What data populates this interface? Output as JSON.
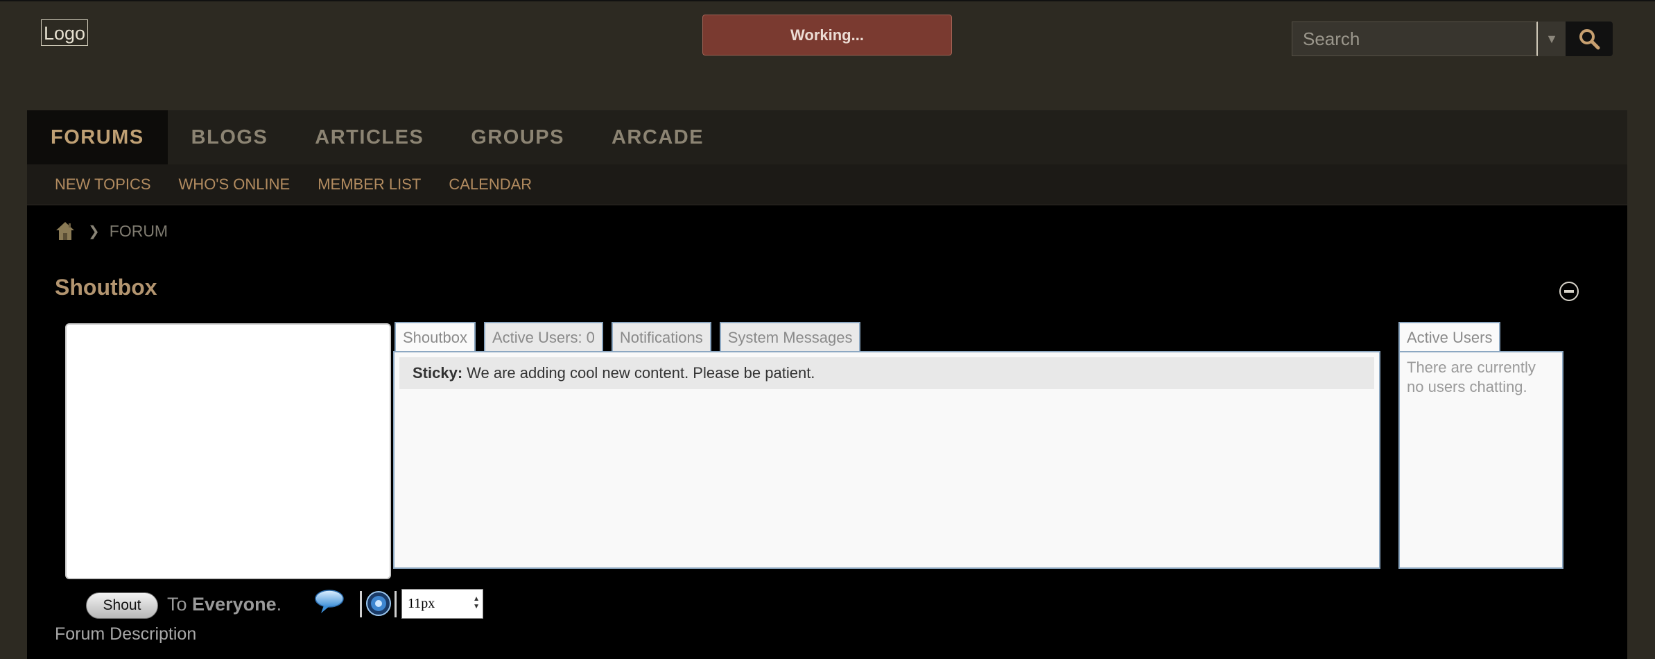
{
  "header": {
    "logo_text": "Logo",
    "status_text": "Working...",
    "search": {
      "placeholder": "Search"
    }
  },
  "nav": {
    "items": [
      {
        "label": "FORUMS",
        "active": true
      },
      {
        "label": "BLOGS"
      },
      {
        "label": "ARTICLES"
      },
      {
        "label": "GROUPS"
      },
      {
        "label": "ARCADE"
      }
    ]
  },
  "subnav": {
    "items": [
      {
        "label": "NEW TOPICS"
      },
      {
        "label": "WHO'S ONLINE"
      },
      {
        "label": "MEMBER LIST"
      },
      {
        "label": "CALENDAR"
      }
    ]
  },
  "breadcrumb": {
    "current": "FORUM"
  },
  "shoutbox": {
    "title": "Shoutbox",
    "tabs": [
      {
        "label": "Shoutbox"
      },
      {
        "label": "Active Users: 0"
      },
      {
        "label": "Notifications"
      },
      {
        "label": "System Messages"
      }
    ],
    "sticky_label": "Sticky:",
    "sticky_text": "We are adding cool new content. Please be patient.",
    "active_users_tab": "Active Users",
    "active_users_text": "There are currently no users chatting.",
    "shout_button": "Shout",
    "to_prefix": "To",
    "to_target": "Everyone",
    "to_suffix": ".",
    "font_size_value": "11px"
  },
  "forum_description": "Forum Description",
  "icons": [
    "search-icon",
    "home-icon",
    "chevron-right-icon",
    "collapse-icon",
    "speech-bubble-icon",
    "sound-icon"
  ]
}
